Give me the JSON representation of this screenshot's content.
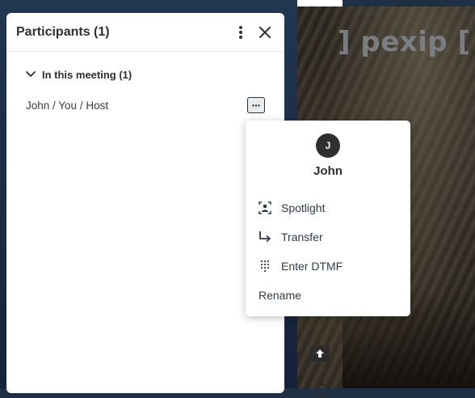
{
  "video": {
    "logo_text": "] pexip ["
  },
  "panel": {
    "title": "Participants (1)",
    "section_label": "In this meeting (1)",
    "participants": [
      {
        "name": "John / You / Host"
      }
    ]
  },
  "menu": {
    "avatar_initial": "J",
    "name": "John",
    "items": [
      {
        "label": "Spotlight",
        "icon": "spotlight-icon"
      },
      {
        "label": "Transfer",
        "icon": "transfer-arrow-icon"
      },
      {
        "label": "Enter DTMF",
        "icon": "keypad-icon"
      },
      {
        "label": "Rename"
      }
    ]
  }
}
